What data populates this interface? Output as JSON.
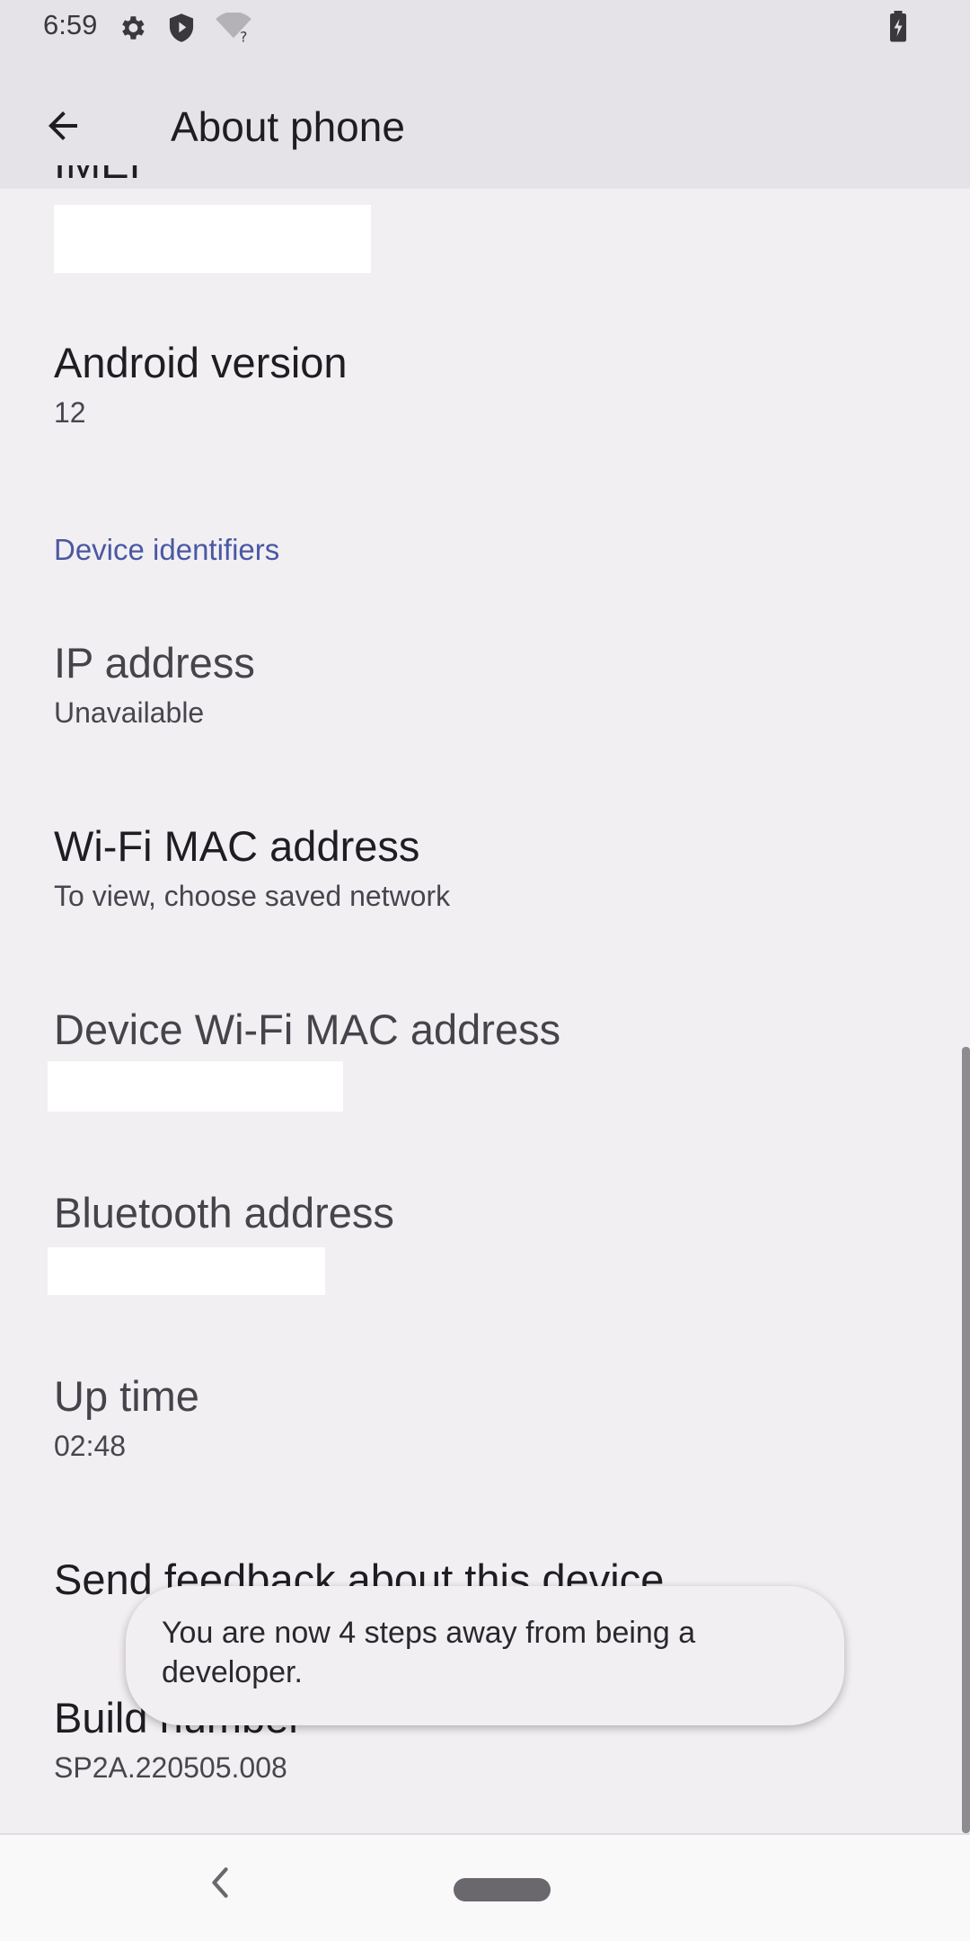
{
  "status_bar": {
    "time": "6:59",
    "icons": [
      "settings-gear-icon",
      "shield-icon",
      "wifi-unknown-icon",
      "battery-charging-icon"
    ]
  },
  "app_bar": {
    "title": "About phone",
    "back_icon": "arrow-back-icon"
  },
  "list": {
    "imei": {
      "title": "IMEI"
    },
    "android_version": {
      "title": "Android version",
      "summary": "12"
    },
    "section_header": "Device identifiers",
    "ip_address": {
      "title": "IP address",
      "summary": "Unavailable"
    },
    "wifi_mac": {
      "title": "Wi-Fi MAC address",
      "summary": "To view, choose saved network"
    },
    "device_wifi_mac": {
      "title": "Device Wi-Fi MAC address"
    },
    "bluetooth": {
      "title": "Bluetooth address"
    },
    "up_time": {
      "title": "Up time",
      "summary": "02:48"
    },
    "feedback": {
      "title": "Send feedback about this device"
    },
    "build_number": {
      "title": "Build number",
      "summary": "SP2A.220505.008"
    }
  },
  "toast": {
    "text": "You are now 4 steps away from being a developer."
  },
  "nav_bar": {
    "back_icon": "nav-back-icon",
    "home_icon": "nav-home-pill-icon"
  },
  "colors": {
    "background": "#f2eff3",
    "app_bar": "#e5e3e8",
    "section_header": "#4a58a3"
  }
}
